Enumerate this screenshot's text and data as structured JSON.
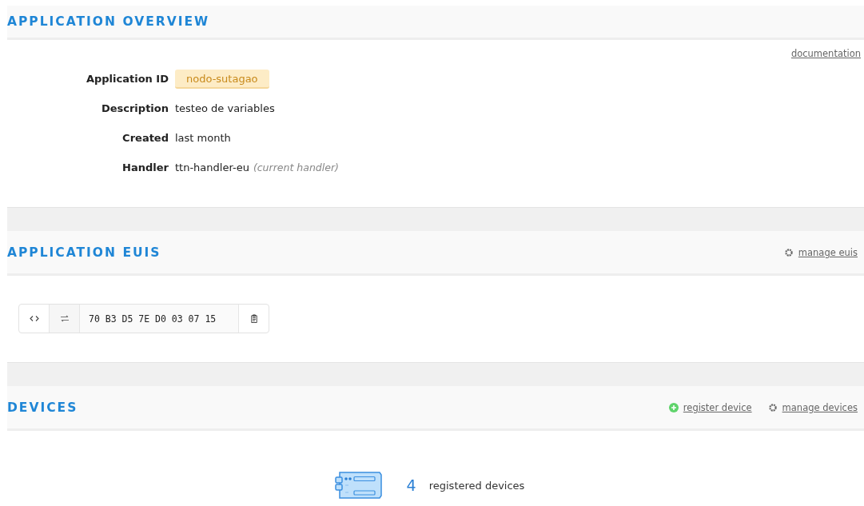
{
  "overview": {
    "title": "APPLICATION OVERVIEW",
    "link": "documentation",
    "fields": [
      {
        "label": "Application ID",
        "value": "nodo-sutagao",
        "kind": "badge"
      },
      {
        "label": "Description",
        "value": "testeo de variables",
        "kind": "text"
      },
      {
        "label": "Created",
        "value": "last month",
        "kind": "text"
      },
      {
        "label": "Handler",
        "value": "ttn-handler-eu",
        "note": "(current handler)",
        "kind": "text"
      }
    ]
  },
  "euis": {
    "title": "APPLICATION EUIS",
    "actions": [
      {
        "label": "manage euis",
        "kind": "settings"
      }
    ],
    "eui": "70 B3 D5 7E D0 03 07 15"
  },
  "devices": {
    "title": "DEVICES",
    "actions": [
      {
        "label": "register device",
        "kind": "add"
      },
      {
        "label": "manage devices",
        "kind": "settings"
      }
    ],
    "count": "4",
    "count_label": "registered devices"
  }
}
